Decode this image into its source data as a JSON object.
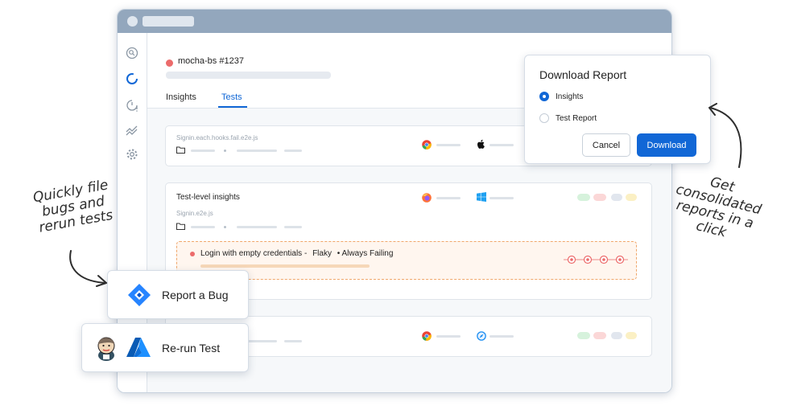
{
  "build": {
    "title": "mocha-bs #1237",
    "status_color": "#ec6b6b"
  },
  "tabs": [
    {
      "label": "Insights"
    },
    {
      "label": "Tests"
    }
  ],
  "active_tab": "Tests",
  "rows": {
    "row1": {
      "file": "Signin.each.hooks.fail.e2e.js",
      "browser_icon": "chrome-icon",
      "os_icon": "apple-icon"
    },
    "row2": {
      "title": "Test-level insights",
      "file": "Signin.e2e.js",
      "browser_icon": "firefox-icon",
      "os_icon": "windows-icon",
      "failure": {
        "text": "Login with empty credentials -",
        "flaky": "Flaky",
        "tag": "Always Failing"
      }
    },
    "row3": {
      "browser_icon": "chrome-icon",
      "os_icon": "safari-icon"
    }
  },
  "download_dialog": {
    "title": "Download Report",
    "options": [
      {
        "label": "Insights",
        "selected": true
      },
      {
        "label": "Test Report",
        "selected": false
      }
    ],
    "cancel_label": "Cancel",
    "download_label": "Download"
  },
  "actions": {
    "report_bug_label": "Report a Bug",
    "rerun_label": "Re-run Test"
  },
  "annotations": {
    "left": [
      "Quickly file",
      "bugs and",
      "rerun tests"
    ],
    "right": [
      "Get",
      "consolidated",
      "reports in a",
      "click"
    ]
  },
  "colors": {
    "accent": "#1167d6",
    "fail": "#ec6b6b",
    "warn_bg": "#fff6ef",
    "warn_border": "#f0a76b"
  }
}
